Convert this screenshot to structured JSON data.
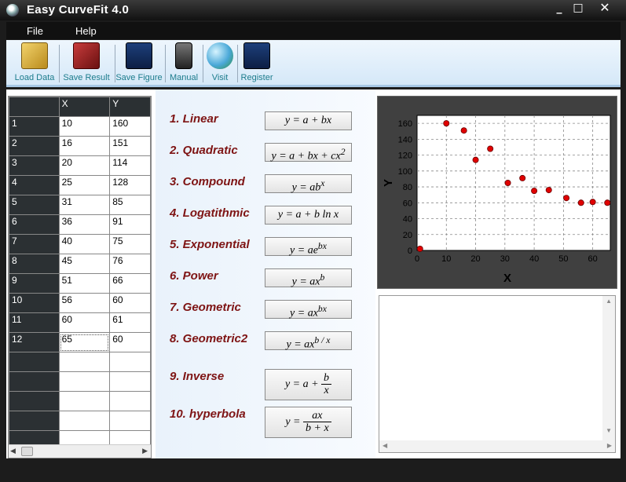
{
  "window": {
    "title": "Easy CurveFit 4.0",
    "minimize": "_",
    "maximize": "□",
    "close": "✕"
  },
  "menu": {
    "file": "File",
    "help": "Help"
  },
  "toolbar": {
    "load_data": "Load Data",
    "save_result": "Save Result",
    "save_figure": "Save Figure",
    "manual": "Manual",
    "visit": "Visit",
    "register": "Register",
    "icons": [
      "folder-icon",
      "book-icon",
      "figure-icon",
      "phone-icon",
      "globe-icon",
      "register-icon"
    ]
  },
  "table": {
    "columns": [
      "",
      "X",
      "Y"
    ],
    "rows": [
      [
        "1",
        "10",
        "160"
      ],
      [
        "2",
        "16",
        "151"
      ],
      [
        "3",
        "20",
        "114"
      ],
      [
        "4",
        "25",
        "128"
      ],
      [
        "5",
        "31",
        "85"
      ],
      [
        "6",
        "36",
        "91"
      ],
      [
        "7",
        "40",
        "75"
      ],
      [
        "8",
        "45",
        "76"
      ],
      [
        "9",
        "51",
        "66"
      ],
      [
        "10",
        "56",
        "60"
      ],
      [
        "11",
        "60",
        "61"
      ],
      [
        "12",
        "65",
        "60"
      ],
      [
        "",
        "",
        ""
      ],
      [
        "",
        "",
        ""
      ],
      [
        "",
        "",
        ""
      ],
      [
        "",
        "",
        ""
      ],
      [
        "",
        "",
        ""
      ]
    ]
  },
  "models": [
    {
      "label": "1.  Linear"
    },
    {
      "label": "2.  Quadratic"
    },
    {
      "label": "3.  Compound"
    },
    {
      "label": "4.  Logatithmic"
    },
    {
      "label": "5.  Exponential"
    },
    {
      "label": "6.  Power"
    },
    {
      "label": "7.  Geometric"
    },
    {
      "label": "8.  Geometric2"
    },
    {
      "label": "9.  Inverse"
    },
    {
      "label": "10.  hyperbola"
    }
  ],
  "formulas": {
    "f1": {
      "a": "y = a + bx"
    },
    "f2": {
      "a": "y = a + bx + cx",
      "sup": "2"
    },
    "f3": {
      "a": "y = ab",
      "sup": "x"
    },
    "f4": {
      "a": "y = a + b ln x"
    },
    "f5": {
      "a": "y = ae",
      "sup": "bx"
    },
    "f6": {
      "a": "y = ax",
      "sup": "b"
    },
    "f7": {
      "a": "y = ax",
      "sup": "bx"
    },
    "f8": {
      "a": "y = ax",
      "sup": "b / x"
    },
    "f9": {
      "a": "y = a +",
      "num": "b",
      "den": "x"
    },
    "f10": {
      "a": "y =",
      "num": "ax",
      "den": "b + x"
    }
  },
  "chart_data": {
    "type": "scatter",
    "x": [
      1,
      10,
      16,
      20,
      25,
      31,
      36,
      40,
      45,
      51,
      56,
      60,
      65
    ],
    "y": [
      2,
      160,
      151,
      114,
      128,
      85,
      91,
      75,
      76,
      66,
      60,
      61,
      60
    ],
    "xlabel": "X",
    "ylabel": "Y",
    "xlim": [
      0,
      66
    ],
    "ylim": [
      0,
      170
    ],
    "xticks": [
      "0",
      "10",
      "20",
      "30",
      "40",
      "50",
      "60"
    ],
    "yticks": [
      "0",
      "20",
      "40",
      "60",
      "80",
      "100",
      "120",
      "140",
      "160"
    ],
    "grid": true,
    "marker_color": "#e00000",
    "background": "#404040",
    "plot_background": "#ffffff"
  }
}
